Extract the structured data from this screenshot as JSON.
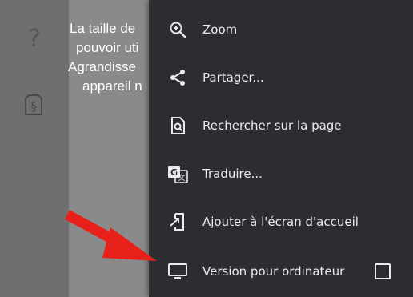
{
  "background_page": {
    "rail_icons": [
      "help-icon",
      "law-icon"
    ],
    "message_lines": [
      "La taille de",
      "pouvoir uti",
      "Agrandisse",
      "appareil n"
    ]
  },
  "menu": {
    "items": [
      {
        "label": "Zoom",
        "icon": "zoom-in-icon"
      },
      {
        "label": "Partager...",
        "icon": "share-icon"
      },
      {
        "label": "Rechercher sur la page",
        "icon": "find-in-page-icon"
      },
      {
        "label": "Traduire...",
        "icon": "translate-icon"
      },
      {
        "label": "Ajouter à l'écran d'accueil",
        "icon": "add-to-home-icon"
      },
      {
        "label": "Version pour ordinateur",
        "icon": "desktop-icon",
        "checked": false
      }
    ]
  },
  "colors": {
    "menu_bg": "#2b2d30",
    "menu_text": "#e8eaed",
    "annotation_arrow": "#e8201a"
  },
  "annotation": {
    "icon": "red-arrow-icon"
  }
}
